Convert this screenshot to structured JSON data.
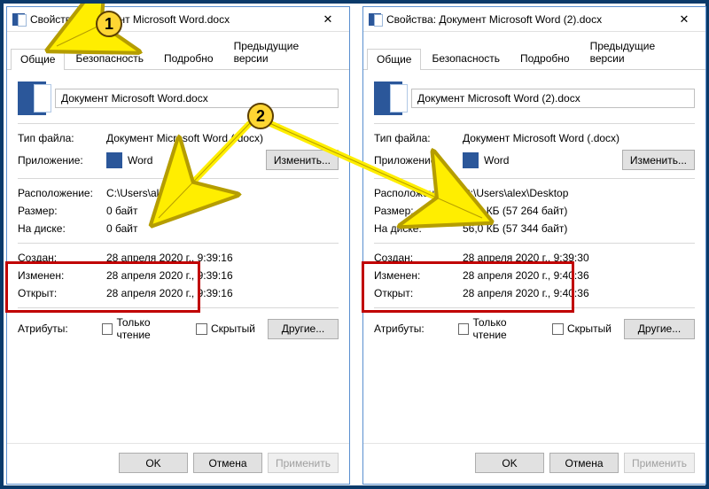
{
  "windows": {
    "left": {
      "title": "Свойства: Документ Microsoft Word.docx",
      "filename": "Документ Microsoft Word.docx",
      "filetype": "Документ Microsoft Word (.docx)",
      "app_name": "Word",
      "location": "C:\\Users\\alex\\Desktop",
      "size": "0 байт",
      "ondisk": "0 байт",
      "created": "28 апреля 2020 г., 9:39:16",
      "modified": "28 апреля 2020 г., 9:39:16",
      "opened": "28 апреля 2020 г., 9:39:16"
    },
    "right": {
      "title": "Свойства: Документ Microsoft Word (2).docx",
      "filename": "Документ Microsoft Word (2).docx",
      "filetype": "Документ Microsoft Word (.docx)",
      "app_name": "Word",
      "location": "C:\\Users\\alex\\Desktop",
      "size": "55,9 КБ (57 264 байт)",
      "ondisk": "56,0 КБ (57 344 байт)",
      "created": "28 апреля 2020 г., 9:39:30",
      "modified": "28 апреля 2020 г., 9:40:36",
      "opened": "28 апреля 2020 г., 9:40:36"
    }
  },
  "tabs": {
    "general": "Общие",
    "security": "Безопасность",
    "details": "Подробно",
    "prev": "Предыдущие версии"
  },
  "labels": {
    "filetype": "Тип файла:",
    "app": "Приложение:",
    "change": "Изменить...",
    "location": "Расположение:",
    "size": "Размер:",
    "ondisk": "На диске:",
    "created": "Создан:",
    "modified": "Изменен:",
    "opened": "Открыт:",
    "attrs": "Атрибуты:",
    "readonly": "Только чтение",
    "hidden": "Скрытый",
    "other": "Другие...",
    "ok": "OK",
    "cancel": "Отмена",
    "apply": "Применить",
    "close_x": "✕"
  },
  "callouts": {
    "one": "1",
    "two": "2"
  }
}
